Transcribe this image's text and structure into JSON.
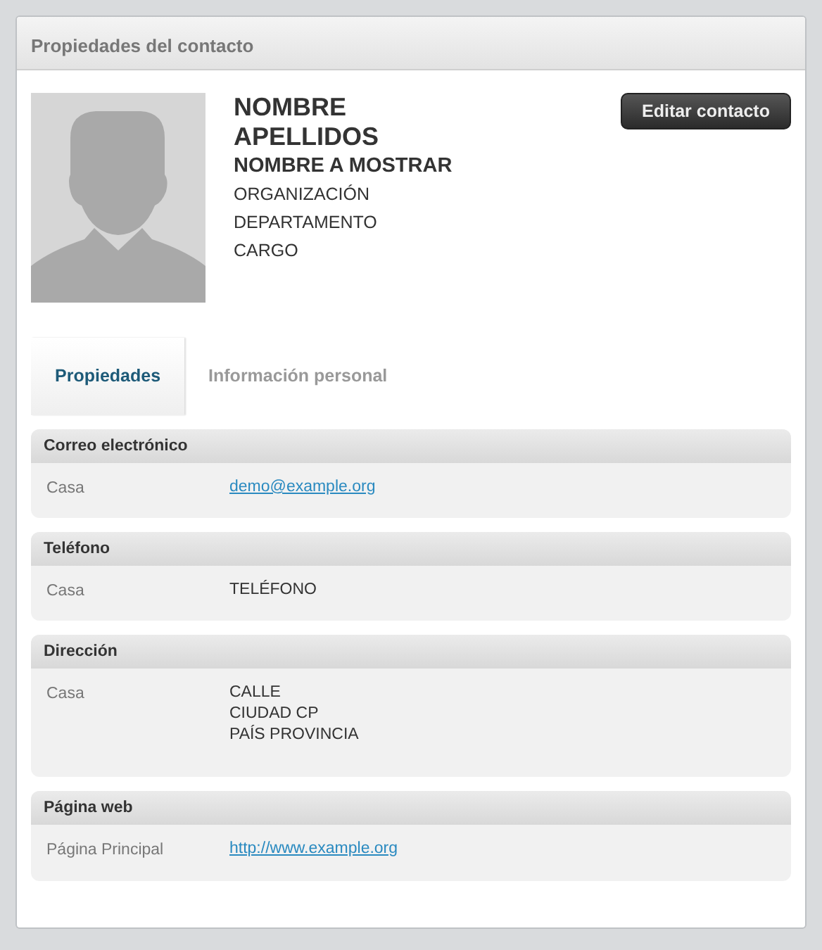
{
  "window": {
    "title": "Propiedades del contacto"
  },
  "contact": {
    "first_name": "NOMBRE",
    "last_name": "APELLIDOS",
    "display_name": "NOMBRE A MOSTRAR",
    "details": [
      "ORGANIZACIÓN",
      "DEPARTAMENTO",
      "CARGO"
    ]
  },
  "edit_button": "Editar contacto",
  "tabs": [
    {
      "label": "Propiedades",
      "selected": true
    },
    {
      "label": "Información personal",
      "selected": false
    }
  ],
  "sections": [
    {
      "title": "Correo electrónico",
      "rows": [
        {
          "label": "Casa",
          "kind": "link",
          "lines": [
            "demo@example.org"
          ]
        }
      ]
    },
    {
      "title": "Teléfono",
      "rows": [
        {
          "label": "Casa",
          "kind": "text",
          "lines": [
            "TELÉFONO"
          ]
        }
      ]
    },
    {
      "title": "Dirección",
      "rows": [
        {
          "label": "Casa",
          "kind": "text",
          "lines": [
            "CALLE",
            "CIUDAD CP",
            "PAÍS PROVINCIA"
          ]
        }
      ]
    },
    {
      "title": "Página web",
      "rows": [
        {
          "label": "Página Principal",
          "kind": "link",
          "lines": [
            "http://www.example.org"
          ]
        }
      ]
    }
  ]
}
